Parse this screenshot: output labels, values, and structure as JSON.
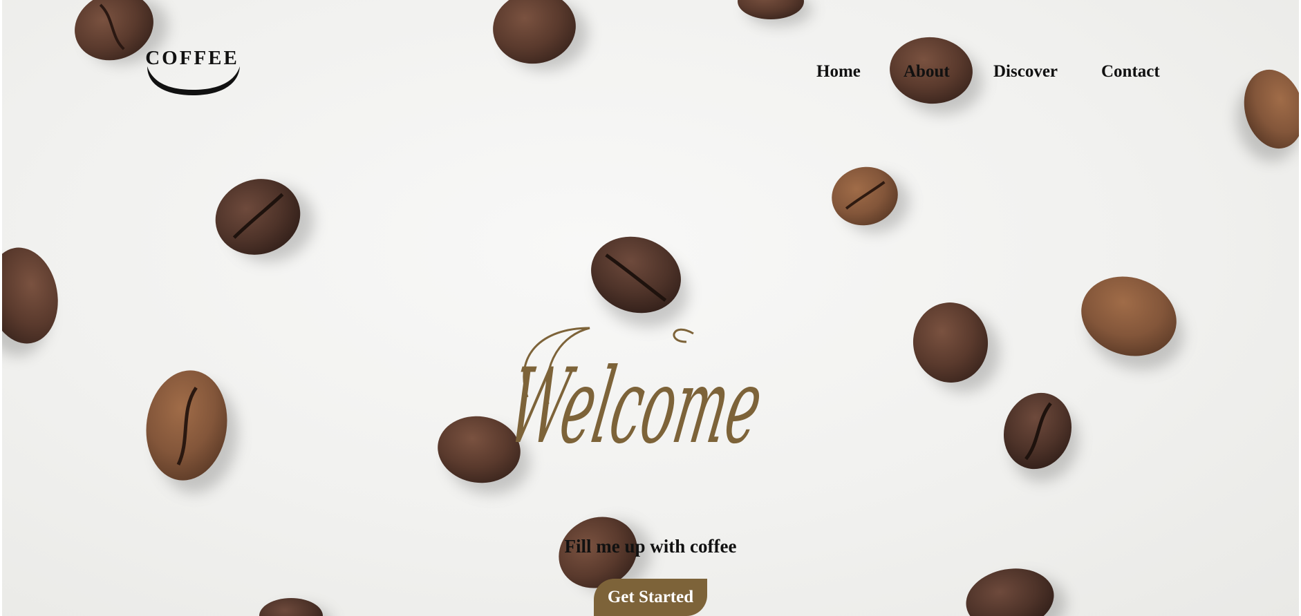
{
  "brand": {
    "logo_text": "COFFEE"
  },
  "nav": {
    "items": [
      {
        "label": "Home"
      },
      {
        "label": "About"
      },
      {
        "label": "Discover"
      },
      {
        "label": "Contact"
      }
    ]
  },
  "hero": {
    "headline": "Welcome",
    "tagline": "Fill me up with coffee",
    "cta_label": "Get Started"
  },
  "colors": {
    "accent": "#7d6339",
    "text": "#111111",
    "background": "#f2f2f0",
    "bean_dark": "#4a3128",
    "bean_light": "#8a5a3c"
  }
}
